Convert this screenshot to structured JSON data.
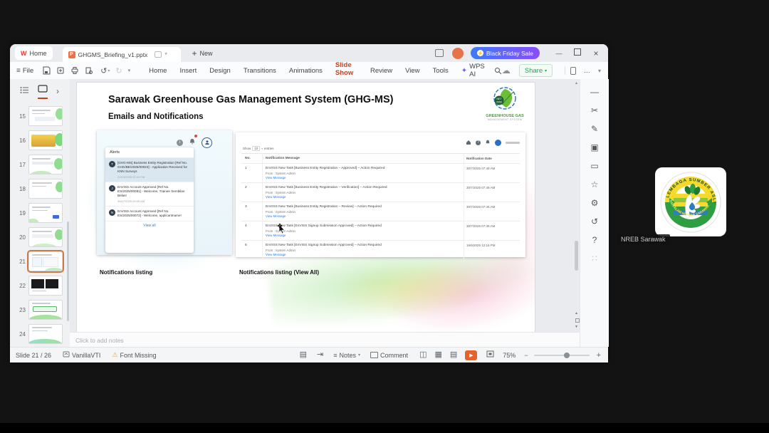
{
  "window": {
    "home_tab": "Home",
    "doc_tab": "GHGMS_Briefing_v1.pptx",
    "modified_mark": "*",
    "new_tab": "New",
    "black_friday": "Black Friday Sale",
    "share": "Share"
  },
  "menu": {
    "file": "File",
    "items": [
      "Home",
      "Insert",
      "Design",
      "Transitions",
      "Animations",
      "Slide Show",
      "Review",
      "View",
      "Tools",
      "WPS AI"
    ],
    "active_item": "Slide Show"
  },
  "icons": {
    "plus": "+",
    "hamburger": "≡",
    "wps_logo": "W",
    "doc_badge": "P",
    "undo": "↺",
    "redo": "↻",
    "caret_down": "▾",
    "chevron_right": "›",
    "cloud": "☁",
    "sparkle": "✦",
    "minimize": "—",
    "close": "×",
    "warning": "⚠",
    "rail_collapse": "—",
    "rail_cut": "✂",
    "rail_edit": "✎",
    "rail_shapes": "▣",
    "rail_comment": "▭",
    "rail_star": "☆",
    "rail_settings": "⚙",
    "rail_history": "↺",
    "rail_help": "?",
    "rail_apps": "∷",
    "sb_pane": "▤",
    "sb_jump": "⇥",
    "view_normal": "◫",
    "view_sorter": "▦",
    "view_read": "▤",
    "play": "▶",
    "fullscreen": "⛶",
    "zoom_minus": "−",
    "zoom_plus": "+",
    "scroll_up": "▲",
    "scroll_prev": "▲",
    "scroll_next": "▼"
  },
  "thumbnails": [
    {
      "number": "15"
    },
    {
      "number": "16"
    },
    {
      "number": "17"
    },
    {
      "number": "18"
    },
    {
      "number": "19"
    },
    {
      "number": "20"
    },
    {
      "number": "21"
    },
    {
      "number": "22"
    },
    {
      "number": "23"
    },
    {
      "number": "24"
    }
  ],
  "slide": {
    "title": "Sarawak Greenhouse Gas Management System (GHG-MS)",
    "subtitle": "Emails and Notifications",
    "logo_line1": "GREENHOUSE GAS",
    "logo_line2": "MANAGEMENT SYSTEM",
    "logo_badge": "NET 2050",
    "caption_left": "Notifications listing",
    "caption_right": "Notifications listing (View All)"
  },
  "alerts": {
    "header": "Alerts",
    "items": [
      {
        "initial": "T",
        "text": "[GHG-MS] Business Entity Registration [Ref No. GHG/BE/2025/00023] - Application Received for KNN Surveys",
        "time": "21/10/2025 02:19 PM"
      },
      {
        "initial": "J",
        "text": "EnVISS Account Approved [Ref No. ES/2025/00081] - Welcome, Trainee Sembilan Belas!",
        "time": "30/07/2025 09:09 AM"
      },
      {
        "initial": "N",
        "text": "EnVISS Account Approved [Ref No. ES/2025/00072] - Welcome, applicantname!",
        "time": ""
      }
    ],
    "view_all": "View all"
  },
  "notif_table": {
    "show_label": "Show",
    "show_value": "10",
    "entries_label": "entries",
    "headers": {
      "no": "No.",
      "message": "Notification Message",
      "date": "Notification Date"
    },
    "from_line": "From : System Admin",
    "link_label": "View Message",
    "rows": [
      {
        "no": "1",
        "message": "EnVISS New Task [Business Entity Registration – Approved] – Action Required",
        "date": "30/7/2025 07:49 AM"
      },
      {
        "no": "2",
        "message": "EnVISS New Task [Business Entity Registration – Verification] – Action Required",
        "date": "30/7/2025 07:49 AM"
      },
      {
        "no": "3",
        "message": "EnVISS New Task [Business Entity Registration – Review] – Action Required",
        "date": "30/7/2025 07:46 AM"
      },
      {
        "no": "4",
        "message": "EnVISS New Task [EnVISS Signup Submission Approved] – Action Required",
        "date": "30/7/2025 07:36 AM"
      },
      {
        "no": "5",
        "message": "EnVISS New Task [EnVISS Signup Submission Approved] – Action Required",
        "date": "16/6/2025 12:16 PM"
      }
    ]
  },
  "notes_placeholder": "Click to add notes",
  "statusbar": {
    "slide_counter": "Slide 21 / 26",
    "vanilla": "VanillaVTI",
    "font_missing": "Font Missing",
    "notes": "Notes",
    "comment": "Comment",
    "zoom": "75%"
  },
  "participant": {
    "name": "NREB Sarawak",
    "logo_arc_top": "LEMBAGA SUMBER ASLI",
    "logo_arc_bottom": "DAN ALAM SEKITAR SARAWAK"
  },
  "colors": {
    "accent_orange": "#c5401f",
    "share_green": "#27a45f",
    "bfs_start": "#3d7bfd",
    "bfs_end": "#8a4df8",
    "link_blue": "#2b7de0",
    "avatar_orange": "#e8734a"
  }
}
